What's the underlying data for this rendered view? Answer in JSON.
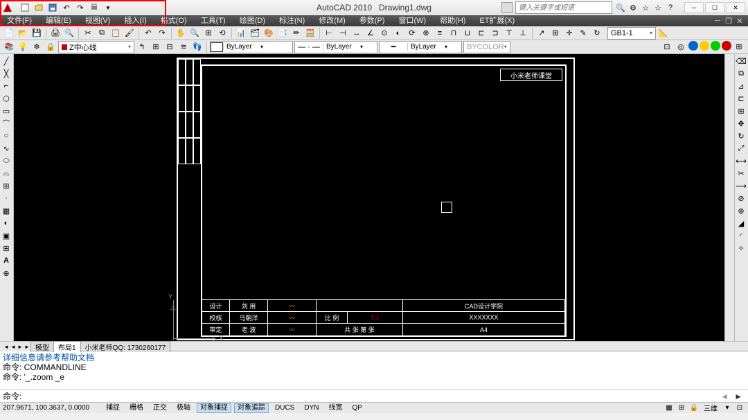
{
  "title": {
    "app": "AutoCAD 2010",
    "file": "Drawing1.dwg"
  },
  "search": {
    "placeholder": "键入关键字或短语"
  },
  "menus": [
    "文件(F)",
    "编辑(E)",
    "视图(V)",
    "插入(I)",
    "格式(O)",
    "工具(T)",
    "绘图(D)",
    "标注(N)",
    "修改(M)",
    "参数(P)",
    "窗口(W)",
    "帮助(H)",
    "ET扩展(X)"
  ],
  "layer": {
    "current": "Z中心线"
  },
  "properties": {
    "color_label": "ByLayer",
    "linetype_label": "ByLayer",
    "lineweight_label": "ByLayer",
    "plotstyle_label": "BYCOLOR",
    "text_style": "GB1-1"
  },
  "drawing": {
    "title_block": "小米老师课堂",
    "table": {
      "rows": [
        {
          "l1": "设计",
          "l2": "刘 用",
          "l3": "",
          "l4": "",
          "l5": "CAD设计学院"
        },
        {
          "l1": "校核",
          "l2": "马朝洋",
          "l3": "",
          "l4": "比 例",
          "l5": "1:1",
          "l6": "XXXXXXX"
        },
        {
          "l1": "审定",
          "l2": "老 波",
          "l3": "",
          "l4": "共 张 第 张",
          "l5": "",
          "l6": "A4"
        }
      ]
    },
    "axes": {
      "y": "Y",
      "x": "X"
    }
  },
  "tabs": {
    "nav": [
      "◄",
      "◄",
      "►",
      "►"
    ],
    "items": [
      "模型",
      "布局1",
      "小米老师QQ: 1730260177"
    ]
  },
  "command": {
    "lines": [
      "详细信息请参考帮助文档",
      "命令: COMMANDLINE",
      "命令: '_.zoom _e"
    ],
    "prompt": "命令:"
  },
  "status": {
    "coords": "207.9671, 100.3637, 0.0000",
    "toggles": [
      "捕捉",
      "栅格",
      "正交",
      "极轴",
      "对象捕捉",
      "对象追踪",
      "DUCS",
      "DYN",
      "线宽",
      "QP"
    ],
    "active_idx": [
      4,
      5
    ],
    "right": "三维"
  }
}
